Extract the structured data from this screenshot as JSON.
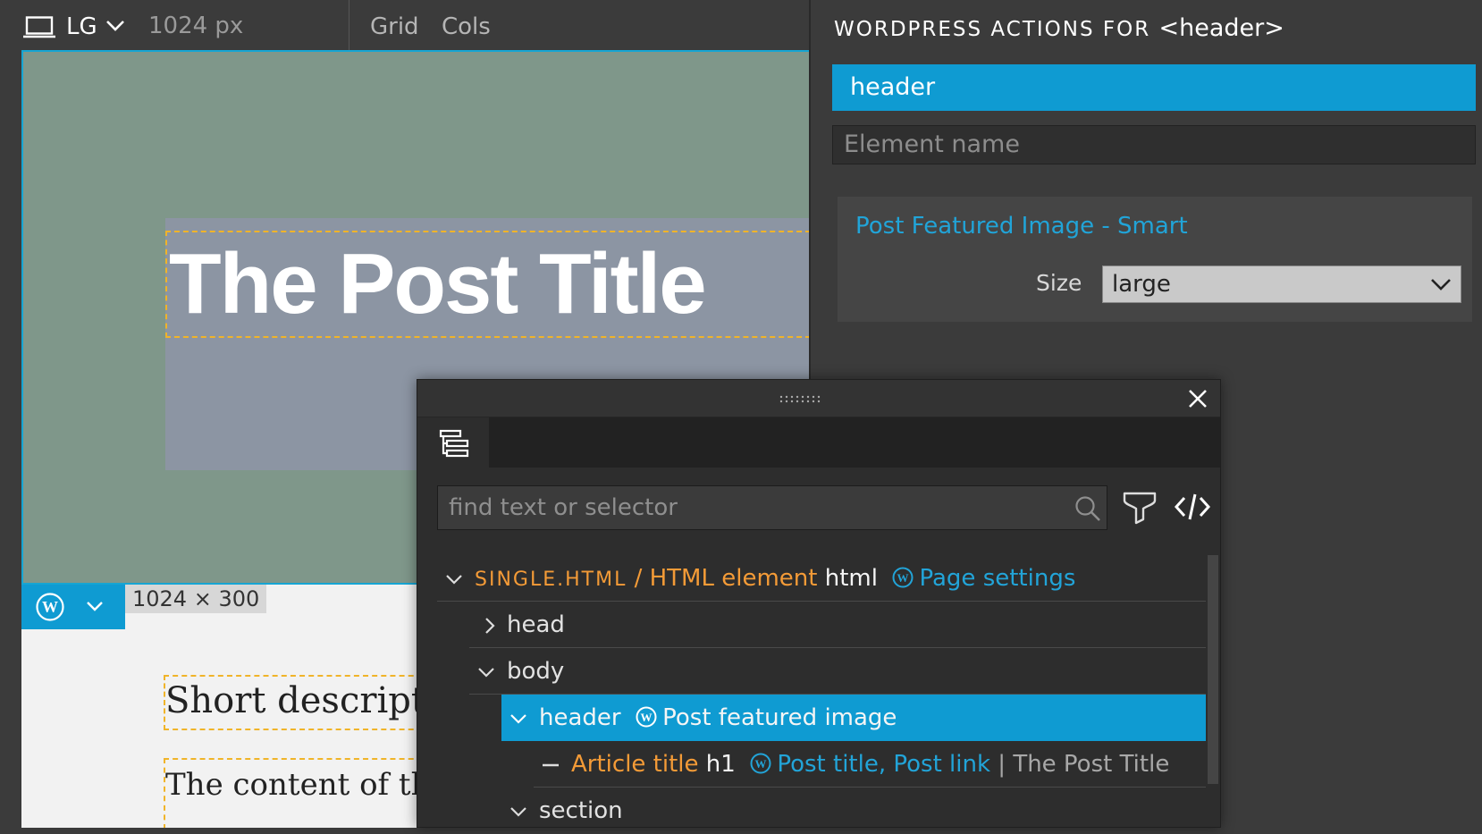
{
  "toolbar": {
    "device_icon": "laptop-icon",
    "breakpoint": "LG",
    "width": "1024 px",
    "grid": "Grid",
    "cols": "Cols"
  },
  "canvas": {
    "post_title": "The Post Title",
    "size_badge": "1024 × 300",
    "short_description": "Short descripti",
    "content": "The content of the",
    "colors": {
      "hero_bg": "#7f978a",
      "selection_outline": "#16a5d3",
      "dashed_outline": "#f0b429"
    }
  },
  "right_panel": {
    "title_prefix": "WORDPRESS ACTIONS FOR",
    "title_tag": "<header>",
    "tag_value": "header",
    "name_placeholder": "Element name",
    "action": {
      "title": "Post Featured Image - Smart",
      "size_label": "Size",
      "size_value": "large"
    }
  },
  "navigator": {
    "search_placeholder": "find text or selector",
    "tree": {
      "root": {
        "file": "SINGLE.HTML",
        "separator": " / ",
        "element_label": "HTML element",
        "tag": "html",
        "action": "Page settings"
      },
      "head": {
        "tag": "head"
      },
      "body": {
        "tag": "body"
      },
      "header": {
        "tag": "header",
        "action": "Post featured image"
      },
      "h1": {
        "label": "Article title",
        "tag": "h1",
        "action": "Post title, Post link",
        "separator": "|",
        "text": "The Post Title"
      },
      "section": {
        "tag": "section"
      }
    }
  },
  "accent_color": "#0f9bd2",
  "highlight_color": "#f49b37"
}
